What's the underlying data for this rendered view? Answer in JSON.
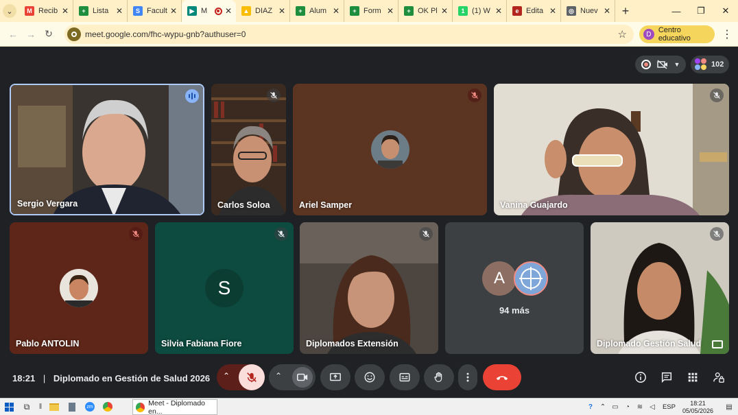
{
  "browser": {
    "tabs": [
      {
        "title": "Recib",
        "icon": "gmail-icon",
        "color": "#ea4335",
        "glyph": "M"
      },
      {
        "title": "Lista",
        "icon": "sheets-icon",
        "color": "#1e8e3e",
        "glyph": "+"
      },
      {
        "title": "Facult",
        "icon": "sites-icon",
        "color": "#4285f4",
        "glyph": "S"
      },
      {
        "title": "M",
        "icon": "meet-icon",
        "color": "#00897b",
        "glyph": "▶",
        "active": true,
        "recording": true
      },
      {
        "title": "DIAZ",
        "icon": "drive-icon",
        "color": "#fbbc04",
        "glyph": "▲"
      },
      {
        "title": "Alum",
        "icon": "sheets-icon",
        "color": "#1e8e3e",
        "glyph": "+"
      },
      {
        "title": "Form",
        "icon": "sheets-icon",
        "color": "#1e8e3e",
        "glyph": "+"
      },
      {
        "title": "OK Pl",
        "icon": "sheets-icon",
        "color": "#1e8e3e",
        "glyph": "+"
      },
      {
        "title": "(1) W",
        "icon": "whatsapp-icon",
        "color": "#25d366",
        "glyph": "1"
      },
      {
        "title": "Edita",
        "icon": "editor-icon",
        "color": "#b3261e",
        "glyph": "e"
      },
      {
        "title": "Nuev",
        "icon": "chrome-icon",
        "color": "#5f6368",
        "glyph": "◎"
      }
    ],
    "url": "meet.google.com/fhc-wypu-gnb?authuser=0",
    "profile_label": "Centro educativo",
    "profile_initial": "D"
  },
  "meeting": {
    "participant_count": "102",
    "time": "18:21",
    "separator": "|",
    "title": "Diplomado en Gestión de Salud 2026",
    "more_label": "94 más",
    "more_initial": "A",
    "tiles": [
      {
        "name": "Sergio Vergara",
        "state": "speaking",
        "bg": "#3a3430"
      },
      {
        "name": "Carlos Soloa",
        "state": "muted",
        "bg": "#3b2a1f"
      },
      {
        "name": "Ariel Samper",
        "state": "muted",
        "bg": "#5b3522"
      },
      {
        "name": "Vanina Guajardo",
        "state": "muted",
        "bg": "#d7d2c8"
      },
      {
        "name": "Pablo ANTOLIN",
        "state": "muted",
        "bg": "#5d2618"
      },
      {
        "name": "Silvia Fabiana Fiore",
        "state": "muted",
        "bg": "#0d4a3f",
        "initial": "S"
      },
      {
        "name": "Diplomados Extensión",
        "state": "muted",
        "bg": "#4d4540"
      },
      {
        "name": "Diplomado Gestión Salud",
        "state": "muted",
        "bg": "#cfcac0"
      }
    ]
  },
  "taskbar": {
    "app_label": "Meet - Diplomado en...",
    "lang": "ESP",
    "time": "18:21",
    "date": "05/05/2026"
  }
}
